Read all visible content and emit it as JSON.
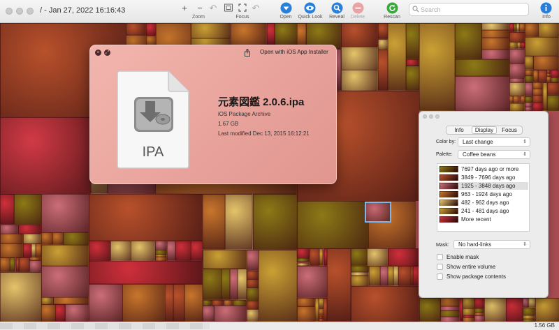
{
  "window": {
    "title": "/ - Jan 27, 2022 16:16:43"
  },
  "toolbar": {
    "zoom_label": "Zoom",
    "focus_label": "Focus",
    "open_label": "Open",
    "quicklook_label": "Quick Look",
    "reveal_label": "Reveal",
    "delete_label": "Delete",
    "rescan_label": "Rescan",
    "info_label": "Info",
    "search_placeholder": "Search",
    "colors": {
      "blue_button": "#2a7fd9",
      "green_button": "#3aa83a",
      "delete_disabled": "#e9a3a3"
    }
  },
  "quicklook": {
    "open_with": "Open with iOS App Installer",
    "file_name": "元素図鑑 2.0.6.ipa",
    "kind": "iOS Package Archive",
    "size": "1.67 GB",
    "modified": "Last modified Dec 13, 2015 16:12:21",
    "doc_extension": "IPA"
  },
  "inspector": {
    "tabs": [
      "Info",
      "Display",
      "Focus"
    ],
    "active_tab": "Display",
    "color_by_label": "Color by:",
    "color_by_value": "Last change",
    "palette_label": "Palette:",
    "palette_value": "Coffee beans",
    "legend": [
      {
        "label": "7697 days ago or more",
        "color": "#8c7a16"
      },
      {
        "label": "3849 - 7696 days ago",
        "color": "#b8512b"
      },
      {
        "label": "1925 - 3848 days ago",
        "color": "#cc6e78"
      },
      {
        "label": "963 - 1924 days ago",
        "color": "#c8762c"
      },
      {
        "label": "482 - 962 days ago",
        "color": "#e4c46a"
      },
      {
        "label": "241 - 481 days ago",
        "color": "#caa034"
      },
      {
        "label": "More recent",
        "color": "#cf2f3a"
      }
    ],
    "selected_legend_index": 2,
    "mask_label": "Mask:",
    "mask_value": "No hard-links",
    "checkboxes": [
      "Enable mask",
      "Show entire volume",
      "Show package contents"
    ]
  },
  "status": {
    "volume_size": "1.56 GB"
  }
}
